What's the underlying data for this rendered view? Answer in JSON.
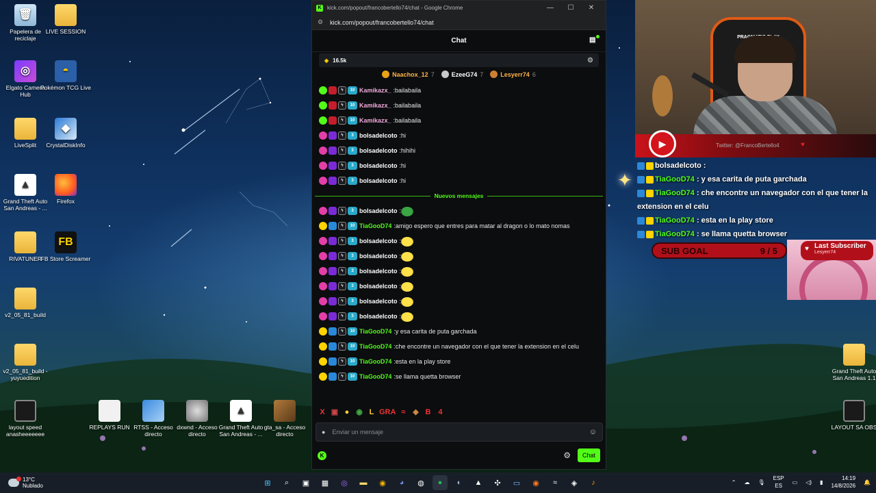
{
  "desktop": {
    "icons_left": [
      {
        "label": "Papelera de reciclaje",
        "glyph": "🗑"
      },
      {
        "label": "LIVE SESSION",
        "glyph": ""
      },
      {
        "label": "Elgato Camera Hub",
        "glyph": "◎"
      },
      {
        "label": "Pokémon TCG Live",
        "glyph": "◓"
      },
      {
        "label": "LiveSplit",
        "glyph": ""
      },
      {
        "label": "CrystalDiskInfo",
        "glyph": "◆"
      },
      {
        "label": "Grand Theft Auto San Andreas - ...",
        "glyph": "▲"
      },
      {
        "label": "Firefox",
        "glyph": ""
      },
      {
        "label": "RIVATUNER",
        "glyph": ""
      },
      {
        "label": "FB Store Screamer",
        "glyph": "FB"
      },
      {
        "label": "v2_05_81_build",
        "glyph": ""
      },
      {
        "label": "v2_05_81_build - yuyuedition",
        "glyph": ""
      },
      {
        "label": "layout speed anasheeeeeee",
        "glyph": ""
      },
      {
        "label": "REPLAYS RUN",
        "glyph": ""
      },
      {
        "label": "RTSS - Acceso directo",
        "glyph": ""
      },
      {
        "label": "dxwnd - Acceso directo",
        "glyph": ""
      },
      {
        "label": "Grand Theft Auto San Andreas - ...",
        "glyph": "▲"
      },
      {
        "label": "gta_sa - Acceso directo",
        "glyph": ""
      }
    ],
    "icons_right": [
      {
        "label": "Grand Theft Auto San Andreas 1.1"
      },
      {
        "label": "LAYOUT SA OBS"
      }
    ]
  },
  "window": {
    "title": "kick.com/popout/francobertello74/chat - Google Chrome",
    "url": "kick.com/popout/francobertello74/chat",
    "controls": {
      "minimize": "—",
      "maximize": "☐",
      "close": "✕"
    }
  },
  "chat": {
    "header": "Chat",
    "pinned_amount": "16.5k",
    "leaders": [
      {
        "name": "Naachox_12",
        "count": "7",
        "color": "#ffb347",
        "medal": "#e8a317"
      },
      {
        "name": "EzeeG74",
        "count": "7",
        "color": "#ffffff",
        "medal": "#c9c9c9"
      },
      {
        "name": "Lesyerr74",
        "count": "6",
        "color": "#ffb347",
        "medal": "#cd7f32"
      }
    ],
    "messages_before": [
      {
        "user": "Kamikazx_",
        "color": "#f0a9d9",
        "badge": "green",
        "level": "10",
        "text": "bailabaila"
      },
      {
        "user": "Kamikazx_",
        "color": "#f0a9d9",
        "badge": "green",
        "level": "10",
        "text": "bailabaila"
      },
      {
        "user": "Kamikazx_",
        "color": "#f0a9d9",
        "badge": "green",
        "level": "10",
        "text": "bailabaila"
      },
      {
        "user": "bolsadelcoto",
        "color": "#ffffff",
        "badge": "pink",
        "level": "3",
        "text": "hi"
      },
      {
        "user": "bolsadelcoto",
        "color": "#ffffff",
        "badge": "pink",
        "level": "3",
        "text": "hihihi"
      },
      {
        "user": "bolsadelcoto",
        "color": "#ffffff",
        "badge": "pink",
        "level": "3",
        "text": "hi"
      },
      {
        "user": "bolsadelcoto",
        "color": "#ffffff",
        "badge": "pink",
        "level": "3",
        "text": "hi"
      }
    ],
    "divider": "Nuevos mensajes",
    "messages_after": [
      {
        "user": "bolsadelcoto",
        "color": "#ffffff",
        "badge": "pink",
        "level": "3",
        "text": "",
        "emote": "frog"
      },
      {
        "user": "TiaGooD74",
        "color": "#53fc18",
        "badge": "gold",
        "level": "10",
        "text": "amigo espero que entres para matar al dragon o lo mato nomas"
      },
      {
        "user": "bolsadelcoto",
        "color": "#ffffff",
        "badge": "pink",
        "level": "3",
        "text": "",
        "emote": "yellow"
      },
      {
        "user": "bolsadelcoto",
        "color": "#ffffff",
        "badge": "pink",
        "level": "3",
        "text": "",
        "emote": "yellow"
      },
      {
        "user": "bolsadelcoto",
        "color": "#ffffff",
        "badge": "pink",
        "level": "3",
        "text": "",
        "emote": "yellow"
      },
      {
        "user": "bolsadelcoto",
        "color": "#ffffff",
        "badge": "pink",
        "level": "3",
        "text": "",
        "emote": "yellow"
      },
      {
        "user": "bolsadelcoto",
        "color": "#ffffff",
        "badge": "pink",
        "level": "3",
        "text": "",
        "emote": "yellow"
      },
      {
        "user": "bolsadelcoto",
        "color": "#ffffff",
        "badge": "pink",
        "level": "3",
        "text": "",
        "emote": "yellow"
      },
      {
        "user": "TiaGooD74",
        "color": "#53fc18",
        "badge": "gold",
        "level": "10",
        "text": "y esa carita de puta garchada"
      },
      {
        "user": "TiaGooD74",
        "color": "#53fc18",
        "badge": "gold",
        "level": "10",
        "text": "che encontre un navegador con el que tener la extension en el celu"
      },
      {
        "user": "TiaGooD74",
        "color": "#53fc18",
        "badge": "gold",
        "level": "10",
        "text": "esta en la play store"
      },
      {
        "user": "TiaGooD74",
        "color": "#53fc18",
        "badge": "gold",
        "level": "10",
        "text": "se llama quetta browser"
      }
    ],
    "emote_bar": [
      "X",
      "▣",
      "●",
      "◉",
      "L",
      "GRA",
      "≈",
      "◆",
      "B",
      "4"
    ],
    "input_placeholder": "Enviar un mensaje",
    "send_button": "Chat",
    "accent": "#53fc18"
  },
  "overlay": {
    "yt_handle": "Twitter: @FrancoBertello4",
    "chair_logo": "PRAGMATIC PLAY",
    "chat_lines": [
      {
        "user": "bolsadelcoto",
        "text": ":"
      },
      {
        "user": "TiaGooD74",
        "text": ": y esa carita de puta garchada"
      },
      {
        "user": "TiaGooD74",
        "text": ": che encontre un navegador con el que tener la extension en el celu"
      },
      {
        "user": "TiaGooD74",
        "text": ": esta en la play store"
      },
      {
        "user": "TiaGooD74",
        "text": ": se llama quetta browser"
      }
    ],
    "sub_goal_label": "SUB GOAL",
    "sub_goal_value": "9 / 5",
    "last_subscriber_label": "Last Subscriber",
    "last_subscriber_name": "Lesyerr74"
  },
  "taskbar": {
    "temperature": "13°C",
    "weather": "Nublado",
    "lang_top": "ESP",
    "lang_bottom": "ES",
    "time": "14:19",
    "date": "14/8/2026"
  }
}
